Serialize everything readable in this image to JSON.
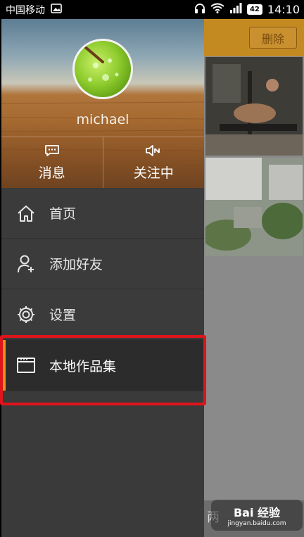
{
  "status_bar": {
    "carrier": "中国移动",
    "battery": "42",
    "time": "14:10"
  },
  "background_page": {
    "delete_label": "删除",
    "bottom_text": "两"
  },
  "drawer": {
    "profile": {
      "username": "michael",
      "actions": [
        {
          "label": "消息",
          "icon": "message-icon"
        },
        {
          "label": "关注中",
          "icon": "speaker-mute-icon"
        }
      ]
    },
    "menu": [
      {
        "label": "首页",
        "icon": "home-icon"
      },
      {
        "label": "添加好友",
        "icon": "add-user-icon"
      },
      {
        "label": "设置",
        "icon": "gear-icon"
      },
      {
        "label": "本地作品集",
        "icon": "folder-icon",
        "active": true
      }
    ]
  },
  "watermark": {
    "title": "Bai 经验",
    "url": "jingyan.baidu.com"
  },
  "colors": {
    "accent": "#f28c1a",
    "highlight": "#e0141b",
    "drawer_bg": "#3b3b3b",
    "active_bg": "#2c2c2c"
  }
}
